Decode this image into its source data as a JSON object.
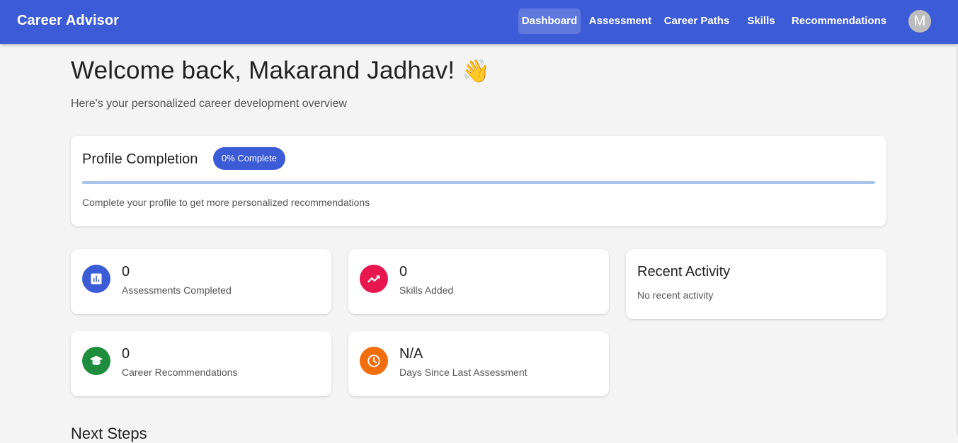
{
  "app": {
    "title": "Career Advisor",
    "avatar_initial": "M"
  },
  "nav": {
    "items": [
      {
        "label": "Dashboard",
        "active": true
      },
      {
        "label": "Assessment",
        "active": false
      },
      {
        "label": "Career Paths",
        "active": false
      },
      {
        "label": "Skills",
        "active": false
      },
      {
        "label": "Recommendations",
        "active": false
      }
    ]
  },
  "header": {
    "welcome": "Welcome back, Makarand Jadhav!",
    "wave_emoji": "👋",
    "subtitle": "Here's your personalized career development overview"
  },
  "profile": {
    "title": "Profile Completion",
    "badge": "0% Complete",
    "completion_percent": 0,
    "hint": "Complete your profile to get more personalized recommendations"
  },
  "stats": [
    {
      "value": "0",
      "label": "Assessments Completed",
      "icon": "bar-chart-icon",
      "color": "#3c5bd6"
    },
    {
      "value": "0",
      "label": "Skills Added",
      "icon": "trending-up-icon",
      "color": "#e8174f"
    },
    {
      "value": "0",
      "label": "Career Recommendations",
      "icon": "graduation-cap-icon",
      "color": "#1e8e3e"
    },
    {
      "value": "N/A",
      "label": "Days Since Last Assessment",
      "icon": "clock-icon",
      "color": "#f26d0c"
    }
  ],
  "activity": {
    "title": "Recent Activity",
    "empty_text": "No recent activity"
  },
  "next_steps": {
    "title": "Next Steps"
  },
  "colors": {
    "primary": "#3c5bd6",
    "background": "#f4f4f4",
    "progress_track": "#a9c4ea"
  }
}
